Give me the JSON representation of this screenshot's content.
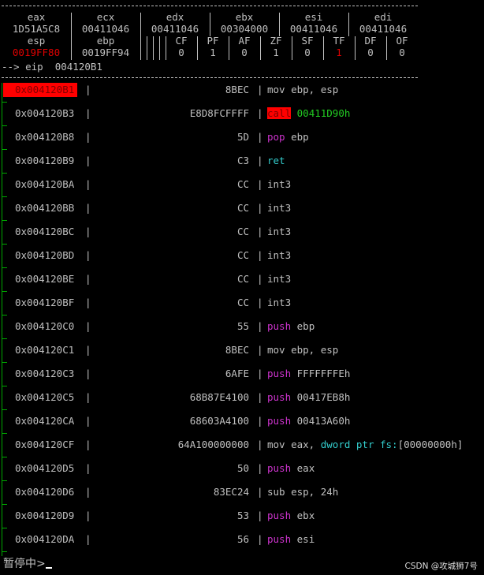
{
  "registers": {
    "eax": {
      "name": "eax",
      "value": "1D51A5C8"
    },
    "ecx": {
      "name": "ecx",
      "value": "00411046"
    },
    "edx": {
      "name": "edx",
      "value": "00411046"
    },
    "ebx": {
      "name": "ebx",
      "value": "00304000"
    },
    "esi": {
      "name": "esi",
      "value": "00411046"
    },
    "edi": {
      "name": "edi",
      "value": "00411046"
    },
    "esp": {
      "name": "esp",
      "value": "0019FF80"
    },
    "ebp": {
      "name": "ebp",
      "value": "0019FF94"
    }
  },
  "flags": [
    {
      "name": "CF",
      "value": "0"
    },
    {
      "name": "PF",
      "value": "1"
    },
    {
      "name": "AF",
      "value": "0"
    },
    {
      "name": "ZF",
      "value": "1"
    },
    {
      "name": "SF",
      "value": "0"
    },
    {
      "name": "TF",
      "value": "1"
    },
    {
      "name": "DF",
      "value": "0"
    },
    {
      "name": "OF",
      "value": "0"
    }
  ],
  "eip_line": "--> eip  004120B1",
  "instructions": [
    {
      "address": "0x004120B1",
      "bytes": "8BEC",
      "mnemonic": "mov",
      "operands": "ebp, esp",
      "current": true
    },
    {
      "address": "0x004120B3",
      "bytes": "E8D8FCFFFF",
      "mnemonic": "call",
      "operands": "00411D90h"
    },
    {
      "address": "0x004120B8",
      "bytes": "5D",
      "mnemonic": "pop",
      "operands": "ebp"
    },
    {
      "address": "0x004120B9",
      "bytes": "C3",
      "mnemonic": "ret",
      "operands": ""
    },
    {
      "address": "0x004120BA",
      "bytes": "CC",
      "mnemonic": "int3",
      "operands": ""
    },
    {
      "address": "0x004120BB",
      "bytes": "CC",
      "mnemonic": "int3",
      "operands": ""
    },
    {
      "address": "0x004120BC",
      "bytes": "CC",
      "mnemonic": "int3",
      "operands": ""
    },
    {
      "address": "0x004120BD",
      "bytes": "CC",
      "mnemonic": "int3",
      "operands": ""
    },
    {
      "address": "0x004120BE",
      "bytes": "CC",
      "mnemonic": "int3",
      "operands": ""
    },
    {
      "address": "0x004120BF",
      "bytes": "CC",
      "mnemonic": "int3",
      "operands": ""
    },
    {
      "address": "0x004120C0",
      "bytes": "55",
      "mnemonic": "push",
      "operands": "ebp"
    },
    {
      "address": "0x004120C1",
      "bytes": "8BEC",
      "mnemonic": "mov",
      "operands": "ebp, esp"
    },
    {
      "address": "0x004120C3",
      "bytes": "6AFE",
      "mnemonic": "push",
      "operands": "FFFFFFFEh"
    },
    {
      "address": "0x004120C5",
      "bytes": "68B87E4100",
      "mnemonic": "push",
      "operands": "00417EB8h"
    },
    {
      "address": "0x004120CA",
      "bytes": "68603A4100",
      "mnemonic": "push",
      "operands": "00413A60h"
    },
    {
      "address": "0x004120CF",
      "bytes": "64A100000000",
      "mnemonic": "mov",
      "operands": "eax, ",
      "operands_cyan": "dword ptr fs:",
      "operands_tail": "[00000000h]"
    },
    {
      "address": "0x004120D5",
      "bytes": "50",
      "mnemonic": "push",
      "operands": "eax"
    },
    {
      "address": "0x004120D6",
      "bytes": "83EC24",
      "mnemonic": "sub",
      "operands": "esp, 24h"
    },
    {
      "address": "0x004120D9",
      "bytes": "53",
      "mnemonic": "push",
      "operands": "ebx"
    },
    {
      "address": "0x004120DA",
      "bytes": "56",
      "mnemonic": "push",
      "operands": "esi"
    }
  ],
  "status": {
    "text": "暂停中>"
  },
  "watermark": "CSDN @攻城狮7号",
  "colors": {
    "background": "#000000",
    "text": "#c0c0c0",
    "highlight": "#ff0000",
    "keyword": "#cc33cc",
    "ret": "#33cccc",
    "target": "#22cc22",
    "gutter": "#00aa00"
  }
}
